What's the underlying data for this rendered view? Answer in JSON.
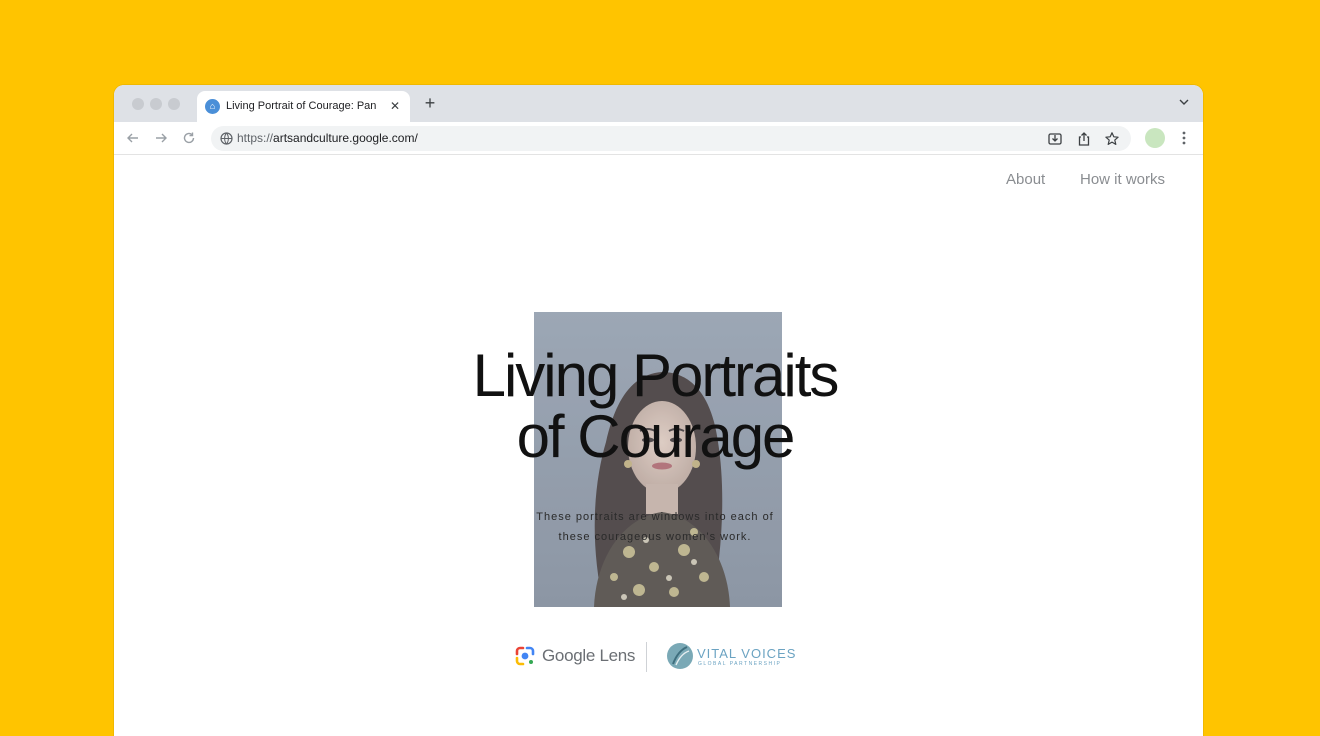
{
  "browser": {
    "tab_title": "Living Portrait of Courage: Pan",
    "tab_close_glyph": "✕",
    "new_tab_glyph": "+",
    "url_scheme": "https://",
    "url_host": "artsandculture.google.com/",
    "icons": {
      "favicon": "arts-culture-favicon-icon",
      "back": "arrow-left-icon",
      "forward": "arrow-right-icon",
      "reload": "reload-icon",
      "site_info": "globe-icon",
      "install": "install-app-icon",
      "share": "share-icon",
      "bookmark": "star-icon",
      "menu": "more-vertical-icon",
      "tab_search": "chevron-down-icon"
    }
  },
  "page": {
    "nav": {
      "about": "About",
      "how_it_works": "How it works"
    },
    "hero": {
      "title_line1": "Living Portraits",
      "title_line2": "of Courage",
      "subtitle_line1": "These portraits are windows into each of",
      "subtitle_line2": "these courageous women's work."
    },
    "partners": {
      "lens": "Google Lens",
      "vital_voices_name": "VITAL VOICES",
      "vital_voices_tagline": "GLOBAL PARTNERSHIP"
    }
  },
  "colors": {
    "background": "#FFC400",
    "title": "#111111",
    "nav_link": "#8a8d91",
    "vital_voices": "#6ba3c2"
  }
}
